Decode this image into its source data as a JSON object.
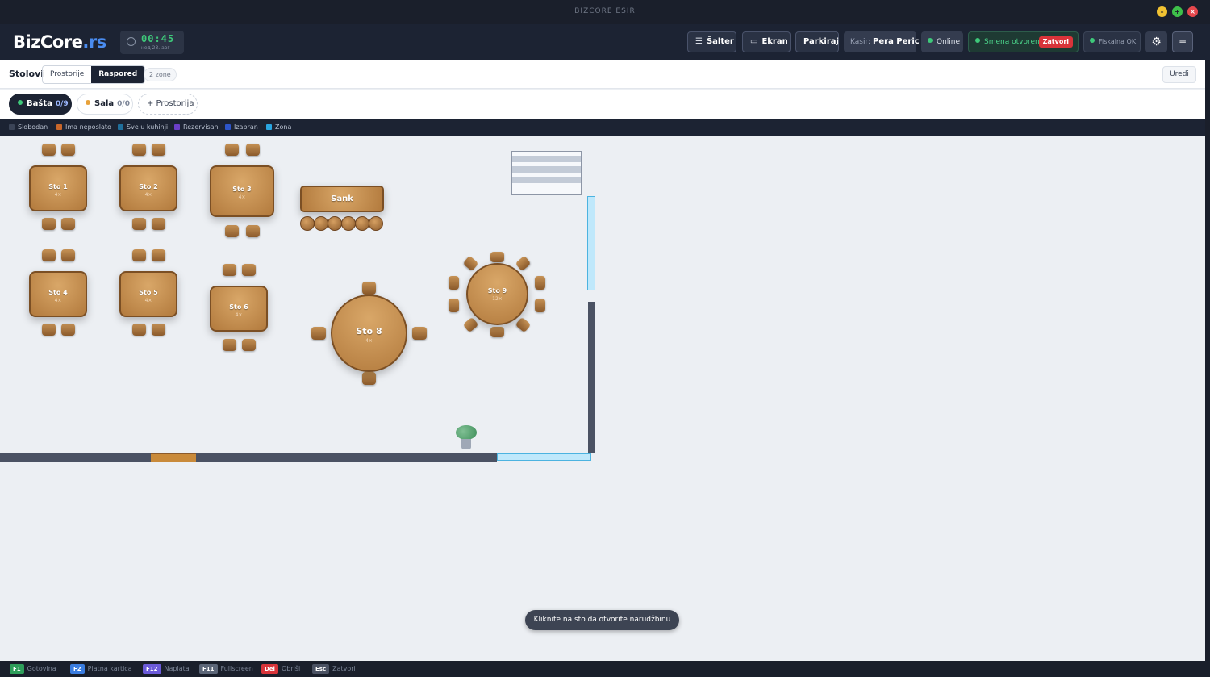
{
  "window": {
    "title": "BIZCORE ESIR"
  },
  "header": {
    "logo_main": "BizCore",
    "logo_accent": ".rs",
    "clock_time": "00:45",
    "clock_date": "нед 23. авг",
    "buttons": {
      "salter": "Šalter",
      "ekran": "Ekran",
      "parkiraj": "Parkiraj"
    },
    "kasir_label": "Kasir:",
    "kasir_name": "Pera Peric",
    "online": "Online",
    "smena": "Smena otvorena",
    "zatvori": "Zatvori",
    "fiskal": "Fiskalna OK"
  },
  "toolbar": {
    "title": "Stolovi",
    "views": [
      "Prostorije",
      "Raspored"
    ],
    "active_view": "Raspored",
    "zones": "2 zone",
    "edit": "Uredi"
  },
  "rooms": [
    {
      "name": "Bašta",
      "count": "0/9",
      "color": "#3ec97a"
    },
    {
      "name": "Sala",
      "count": "0/0",
      "color": "#e8a23a"
    }
  ],
  "add_room": "+ Prostorija",
  "legend": [
    {
      "label": "Slobodan",
      "color": "#3b4457"
    },
    {
      "label": "Ima neposlato",
      "color": "#c8662a"
    },
    {
      "label": "Sve u kuhinji",
      "color": "#1f6f9c"
    },
    {
      "label": "Rezervisan",
      "color": "#6b3fc9"
    },
    {
      "label": "Izabran",
      "color": "#2d55c9"
    },
    {
      "label": "Zona",
      "color": "#2aa5e0"
    }
  ],
  "tables": [
    {
      "name": "Sto 1",
      "cap": "4"
    },
    {
      "name": "Sto 2",
      "cap": "4"
    },
    {
      "name": "Sto 3",
      "cap": "4"
    },
    {
      "name": "Sto 4",
      "cap": "4"
    },
    {
      "name": "Sto 5",
      "cap": "4"
    },
    {
      "name": "Sto 6",
      "cap": "4"
    },
    {
      "name": "Sto 8",
      "cap": "4"
    },
    {
      "name": "Sto 9",
      "cap": "12"
    }
  ],
  "bar": {
    "name": "Sank"
  },
  "hint": "Kliknite na sto da otvorite narudžbinu",
  "shortcuts": [
    {
      "key": "F1",
      "label": "Gotovina",
      "color": "#2e9e5a"
    },
    {
      "key": "F2",
      "label": "Platna kartica",
      "color": "#3b7de0"
    },
    {
      "key": "F12",
      "label": "Naplata",
      "color": "#6b5ad9"
    },
    {
      "key": "F11",
      "label": "Fullscreen",
      "color": "#5c6678"
    },
    {
      "key": "Del",
      "label": "Obriši",
      "color": "#d9343a"
    },
    {
      "key": "Esc",
      "label": "Zatvori",
      "color": "#4b5263"
    }
  ]
}
